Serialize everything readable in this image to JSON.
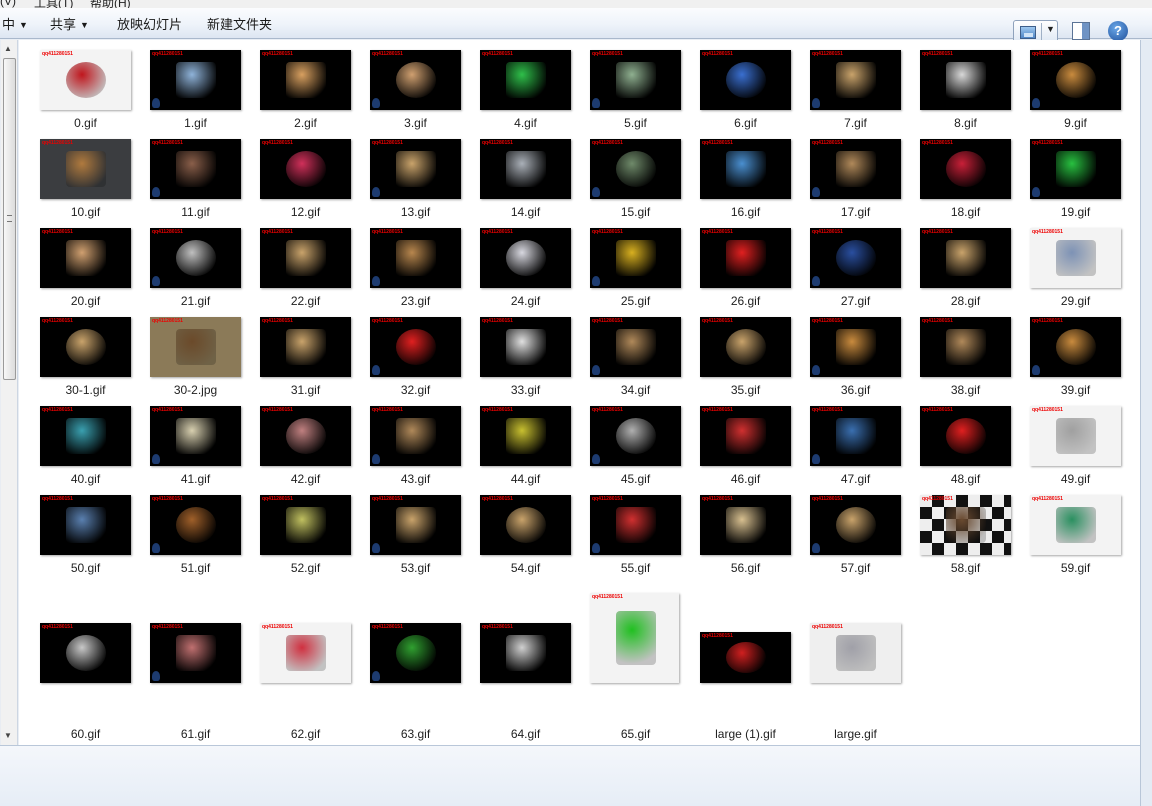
{
  "menubar": {
    "items": [
      "(V)",
      "工具(T)",
      "帮助(H)"
    ]
  },
  "toolbar": {
    "partial_label": "中",
    "share_label": "共享",
    "slideshow_label": "放映幻灯片",
    "new_folder_label": "新建文件夹",
    "help_label": "?"
  },
  "watermark": "qq411280151",
  "files": [
    {
      "name": "0.gif",
      "bg": "light",
      "accent": "#c0161d"
    },
    {
      "name": "1.gif",
      "bg": "dark",
      "accent": "#8fb3d9"
    },
    {
      "name": "2.gif",
      "bg": "dark",
      "accent": "#d8a060"
    },
    {
      "name": "3.gif",
      "bg": "dark",
      "accent": "#d0a070"
    },
    {
      "name": "4.gif",
      "bg": "dark",
      "accent": "#2fbf4a"
    },
    {
      "name": "5.gif",
      "bg": "dark",
      "accent": "#8fb090"
    },
    {
      "name": "6.gif",
      "bg": "dark",
      "accent": "#3a6fd0"
    },
    {
      "name": "7.gif",
      "bg": "dark",
      "accent": "#c9a36b"
    },
    {
      "name": "8.gif",
      "bg": "dark",
      "accent": "#d8d8d8"
    },
    {
      "name": "9.gif",
      "bg": "dark",
      "accent": "#c98b3e"
    },
    {
      "name": "10.gif",
      "bg": "gray",
      "accent": "#b07a3e"
    },
    {
      "name": "11.gif",
      "bg": "dark",
      "accent": "#8a5f4a"
    },
    {
      "name": "12.gif",
      "bg": "dark",
      "accent": "#d0305a"
    },
    {
      "name": "13.gif",
      "bg": "dark",
      "accent": "#c9a36b"
    },
    {
      "name": "14.gif",
      "bg": "dark",
      "accent": "#aab0b8"
    },
    {
      "name": "15.gif",
      "bg": "dark",
      "accent": "#6f8a6a"
    },
    {
      "name": "16.gif",
      "bg": "dark",
      "accent": "#4a8fd0"
    },
    {
      "name": "17.gif",
      "bg": "dark",
      "accent": "#b0895a"
    },
    {
      "name": "18.gif",
      "bg": "dark",
      "accent": "#c82038"
    },
    {
      "name": "19.gif",
      "bg": "dark",
      "accent": "#28c040"
    },
    {
      "name": "20.gif",
      "bg": "dark",
      "accent": "#d0a070"
    },
    {
      "name": "21.gif",
      "bg": "dark",
      "accent": "#c0c0c0"
    },
    {
      "name": "22.gif",
      "bg": "dark",
      "accent": "#c9a36b"
    },
    {
      "name": "23.gif",
      "bg": "dark",
      "accent": "#b8874e"
    },
    {
      "name": "24.gif",
      "bg": "dark",
      "accent": "#d8d8e0"
    },
    {
      "name": "25.gif",
      "bg": "dark",
      "accent": "#d8b020"
    },
    {
      "name": "26.gif",
      "bg": "dark",
      "accent": "#e02020"
    },
    {
      "name": "27.gif",
      "bg": "dark",
      "accent": "#2a4fa0"
    },
    {
      "name": "28.gif",
      "bg": "dark",
      "accent": "#c9a36b"
    },
    {
      "name": "29.gif",
      "bg": "light",
      "accent": "#7d92b5"
    },
    {
      "name": "30-1.gif",
      "bg": "dark",
      "accent": "#c9a36b"
    },
    {
      "name": "30-2.jpg",
      "bg": "tan",
      "accent": "#6b4a2a"
    },
    {
      "name": "31.gif",
      "bg": "dark",
      "accent": "#c9a36b"
    },
    {
      "name": "32.gif",
      "bg": "dark",
      "accent": "#e02020"
    },
    {
      "name": "33.gif",
      "bg": "dark",
      "accent": "#e0e0e0"
    },
    {
      "name": "34.gif",
      "bg": "dark",
      "accent": "#b0895a"
    },
    {
      "name": "35.gif",
      "bg": "dark",
      "accent": "#c9a36b"
    },
    {
      "name": "36.gif",
      "bg": "dark",
      "accent": "#c98b3e"
    },
    {
      "name": "38.gif",
      "bg": "dark",
      "accent": "#b0895a"
    },
    {
      "name": "39.gif",
      "bg": "dark",
      "accent": "#c98b3e"
    },
    {
      "name": "40.gif",
      "bg": "dark",
      "accent": "#3aa0b0"
    },
    {
      "name": "41.gif",
      "bg": "dark",
      "accent": "#d8d0b0"
    },
    {
      "name": "42.gif",
      "bg": "dark",
      "accent": "#c08080"
    },
    {
      "name": "43.gif",
      "bg": "dark",
      "accent": "#b0895a"
    },
    {
      "name": "44.gif",
      "bg": "dark",
      "accent": "#c8c030"
    },
    {
      "name": "45.gif",
      "bg": "dark",
      "accent": "#b0b0b0"
    },
    {
      "name": "46.gif",
      "bg": "dark",
      "accent": "#d03030"
    },
    {
      "name": "47.gif",
      "bg": "dark",
      "accent": "#3a6fb0"
    },
    {
      "name": "48.gif",
      "bg": "dark",
      "accent": "#e02020"
    },
    {
      "name": "49.gif",
      "bg": "light",
      "accent": "#a0a0a0"
    },
    {
      "name": "50.gif",
      "bg": "dark",
      "accent": "#5a80b0"
    },
    {
      "name": "51.gif",
      "bg": "dark",
      "accent": "#a0602a"
    },
    {
      "name": "52.gif",
      "bg": "dark",
      "accent": "#c0c060"
    },
    {
      "name": "53.gif",
      "bg": "dark",
      "accent": "#c9a36b"
    },
    {
      "name": "54.gif",
      "bg": "dark",
      "accent": "#c9a36b"
    },
    {
      "name": "55.gif",
      "bg": "dark",
      "accent": "#d03030"
    },
    {
      "name": "56.gif",
      "bg": "dark",
      "accent": "#d8c090"
    },
    {
      "name": "57.gif",
      "bg": "dark",
      "accent": "#c9a36b"
    },
    {
      "name": "58.gif",
      "bg": "check",
      "accent": "#6a4a30"
    },
    {
      "name": "59.gif",
      "bg": "light",
      "accent": "#2a9060"
    },
    {
      "name": "60.gif",
      "bg": "dark",
      "accent": "#c8c8c8"
    },
    {
      "name": "61.gif",
      "bg": "dark",
      "accent": "#c07070"
    },
    {
      "name": "62.gif",
      "bg": "light",
      "accent": "#d03040"
    },
    {
      "name": "63.gif",
      "bg": "dark",
      "accent": "#30a030"
    },
    {
      "name": "64.gif",
      "bg": "dark",
      "accent": "#d0d0d0"
    },
    {
      "name": "65.gif",
      "bg": "light",
      "accent": "#20c020"
    },
    {
      "name": "large (1).gif",
      "bg": "light",
      "accent": "#d02020"
    },
    {
      "name": "large.gif",
      "bg": "light",
      "accent": "#a0a0a8"
    }
  ]
}
